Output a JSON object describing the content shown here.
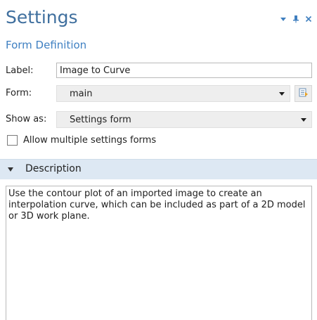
{
  "header": {
    "title": "Settings",
    "subtitle": "Form Definition"
  },
  "window_controls": {
    "icons": [
      "dropdown-icon",
      "pin-icon",
      "close-icon"
    ]
  },
  "fields": {
    "label": {
      "label": "Label:",
      "value": "Image to Curve"
    },
    "form": {
      "label": "Form:",
      "value": "main"
    },
    "show_as": {
      "label": "Show as:",
      "value": "Settings form"
    }
  },
  "checkbox": {
    "label": "Allow multiple settings forms",
    "checked": false
  },
  "description": {
    "title": "Description",
    "text": "Use the contour plot of an imported image to create an interpolation curve, which can be included as part of a 2D model or 3D work plane."
  },
  "colors": {
    "title": "#3f6f9e",
    "subtitle": "#3f80c2",
    "section_bg": "#dde8f3"
  }
}
